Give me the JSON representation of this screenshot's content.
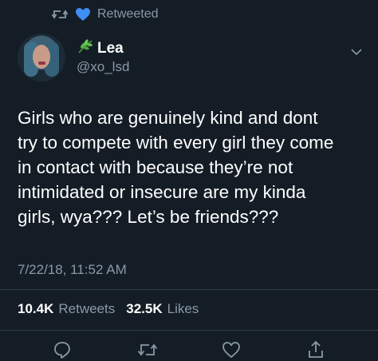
{
  "retweet_header": {
    "label": "Retweeted",
    "retweet_icon": "retweet-icon",
    "heart_icon": "blue-heart-emoji",
    "heart_color": "#3d8ff2"
  },
  "author": {
    "name": "Lea",
    "name_emoji": "herb-emoji",
    "handle": "@xo_lsd",
    "avatar_icon": "profile-photo"
  },
  "tweet": {
    "lines": [
      "Girls who are genuinely kind and dont",
      "try to compete with every girl they come",
      "in contact with because they’re not",
      "intimidated or insecure are my kinda",
      "girls, wya??? Let’s be friends???"
    ],
    "timestamp": "7/22/18, 11:52 AM"
  },
  "stats": {
    "retweets_count": "10.4K",
    "retweets_label": "Retweets",
    "likes_count": "32.5K",
    "likes_label": "Likes"
  },
  "actions": [
    "reply-icon",
    "retweet-icon",
    "like-icon",
    "share-icon"
  ],
  "colors": {
    "background": "#141d26",
    "text": "#ffffff",
    "secondary": "#8899a6",
    "divider": "#2f3e4c"
  }
}
